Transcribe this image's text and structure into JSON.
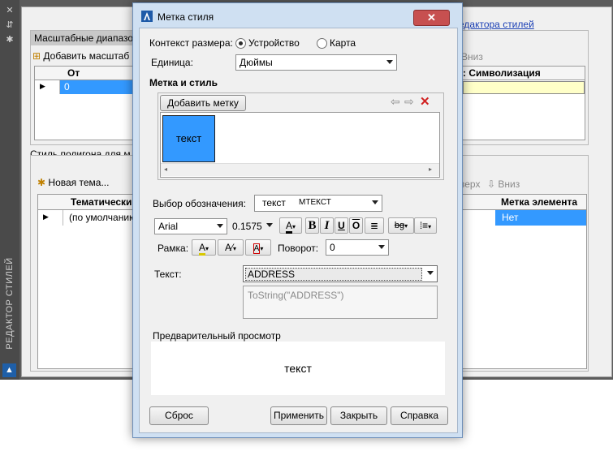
{
  "background": {
    "side_title": "РЕДАКТОР СТИЛЕЙ",
    "link_text": "едактора стилей",
    "scale_pane": {
      "header": "Масштабные диапазо",
      "add_button": "Добавить масштаб",
      "down_label": "Вниз",
      "col_from": "От",
      "row_value": "0",
      "col_symbolization": ": Символизация"
    },
    "polygon_pane": {
      "header": "Стиль полигона для м",
      "new_theme": "Новая тема...",
      "up_label": "верх",
      "down_label": "Вниз",
      "col_thematic": "Тематически",
      "col_label": "Метка элемента",
      "row_thematic": "(по умолчанию)",
      "row_label": "Нет"
    }
  },
  "dialog": {
    "title": "Метка стиля",
    "context_label": "Контекст размера:",
    "radio_device": "Устройство",
    "radio_map": "Карта",
    "unit_label": "Единица:",
    "unit_value": "Дюймы",
    "section_label_style": "Метка и стиль",
    "add_label_button": "Добавить метку",
    "sample_text": "текст",
    "symbol_label": "Выбор обозначения:",
    "symbol_sample": "текст",
    "symbol_value": "МТЕКСТ",
    "font_value": "Arial",
    "size_value": "0.1575",
    "frame_label": "Рамка:",
    "rotation_label": "Поворот:",
    "rotation_value": "0",
    "text_label": "Текст:",
    "text_value": "ADDRESS",
    "expression": "ToString(\"ADDRESS\")",
    "preview_label": "Предварительный просмотр",
    "preview_text": "текст",
    "buttons": {
      "reset": "Сброс",
      "apply": "Применить",
      "close": "Закрыть",
      "help": "Справка"
    }
  },
  "colors": {
    "selection": "#3399ff",
    "delete_red": "#d02020",
    "highlight_yellow": "#ffffc8"
  }
}
